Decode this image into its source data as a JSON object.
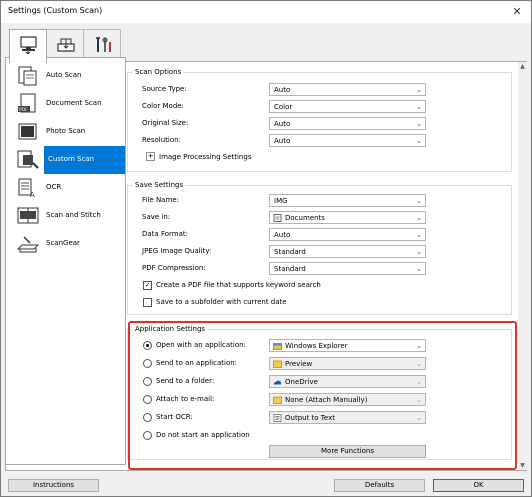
{
  "window": {
    "title": "Settings (Custom Scan)",
    "close_glyph": "✕"
  },
  "top_tabs": [
    {
      "name": "scan-from-computer-tab",
      "icon": "computer-scan-icon",
      "active": true
    },
    {
      "name": "scan-from-operation-panel-tab",
      "icon": "scanner-tray-icon",
      "active": false
    },
    {
      "name": "general-settings-tab",
      "icon": "tools-icon",
      "active": false
    }
  ],
  "sidebar": {
    "items": [
      {
        "label": "Auto Scan",
        "icon": "auto-scan-icon",
        "selected": false
      },
      {
        "label": "Document Scan",
        "icon": "document-scan-icon",
        "selected": false
      },
      {
        "label": "Photo Scan",
        "icon": "photo-scan-icon",
        "selected": false
      },
      {
        "label": "Custom Scan",
        "icon": "custom-scan-icon",
        "selected": true
      },
      {
        "label": "OCR",
        "icon": "ocr-icon",
        "selected": false
      },
      {
        "label": "Scan and Stitch",
        "icon": "scan-and-stitch-icon",
        "selected": false
      },
      {
        "label": "ScanGear",
        "icon": "scangear-icon",
        "selected": false
      }
    ]
  },
  "scan_options": {
    "title": "Scan Options",
    "source_type": {
      "label": "Source Type:",
      "value": "Auto"
    },
    "color_mode": {
      "label": "Color Mode:",
      "value": "Color"
    },
    "original_size": {
      "label": "Original Size:",
      "value": "Auto"
    },
    "resolution": {
      "label": "Resolution:",
      "value": "Auto"
    },
    "image_processing": {
      "label": "Image Processing Settings",
      "expand_glyph": "+"
    }
  },
  "save_settings": {
    "title": "Save Settings",
    "file_name": {
      "label": "File Name:",
      "value": "IMG"
    },
    "save_in": {
      "label": "Save in:",
      "value": "Documents",
      "icon": "documents-folder-icon"
    },
    "data_format": {
      "label": "Data Format:",
      "value": "Auto"
    },
    "jpeg_quality": {
      "label": "JPEG Image Quality:",
      "value": "Standard"
    },
    "pdf_compression": {
      "label": "PDF Compression:",
      "value": "Standard"
    },
    "create_pdf_keyword": {
      "label": "Create a PDF file that supports keyword search",
      "checked": true,
      "check_glyph": "✓"
    },
    "save_subfolder": {
      "label": "Save to a subfolder with current date",
      "checked": false
    }
  },
  "application_settings": {
    "title": "Application Settings",
    "options": [
      {
        "label": "Open with an application:",
        "value": "Windows Explorer",
        "icon": "windows-explorer-icon",
        "selected": true
      },
      {
        "label": "Send to an application:",
        "value": "Preview",
        "icon": "folder-icon",
        "selected": false
      },
      {
        "label": "Send to a folder:",
        "value": "OneDrive",
        "icon": "onedrive-icon",
        "selected": false
      },
      {
        "label": "Attach to e-mail:",
        "value": "None (Attach Manually)",
        "icon": "folder-icon",
        "selected": false
      },
      {
        "label": "Start OCR:",
        "value": "Output to Text",
        "icon": "text-output-icon",
        "selected": false
      },
      {
        "label": "Do not start an application",
        "value": null,
        "selected": false
      }
    ],
    "more_functions": "More Functions"
  },
  "footer": {
    "instructions": "Instructions",
    "defaults": "Defaults",
    "ok": "OK"
  },
  "colors": {
    "accent": "#0078d7",
    "highlight_border": "#e03030"
  }
}
